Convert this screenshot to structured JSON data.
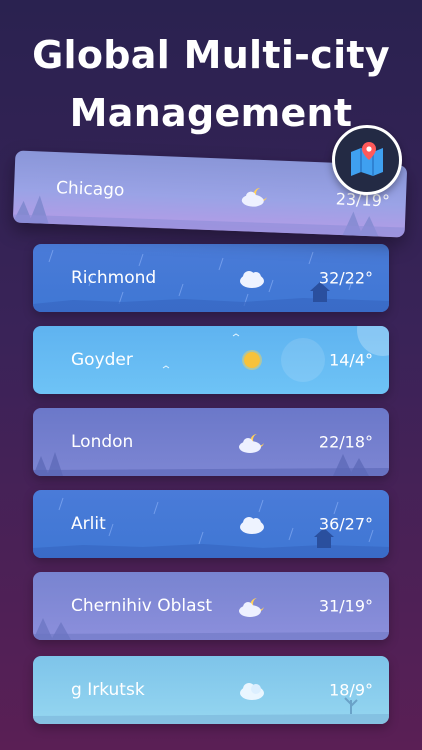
{
  "headline": {
    "line1": "Global Multi-city",
    "line2": "Management"
  },
  "cities": [
    {
      "name": "Chicago",
      "temp": "23/19°",
      "icon": "moon-cloud-icon"
    },
    {
      "name": "Richmond",
      "temp": "32/22°",
      "icon": "cloud-icon"
    },
    {
      "name": "Goyder",
      "temp": "14/4°",
      "icon": "sun-icon"
    },
    {
      "name": "London",
      "temp": "22/18°",
      "icon": "moon-cloud-icon"
    },
    {
      "name": "Arlit",
      "temp": "36/27°",
      "icon": "cloud-icon"
    },
    {
      "name": "Chernihiv Oblast",
      "temp": "31/19°",
      "icon": "moon-cloud-icon"
    },
    {
      "name": "g Irkutsk",
      "temp": "18/9°",
      "icon": "haze-cloud-icon"
    }
  ],
  "badge": {
    "icon": "map-pin-icon"
  }
}
